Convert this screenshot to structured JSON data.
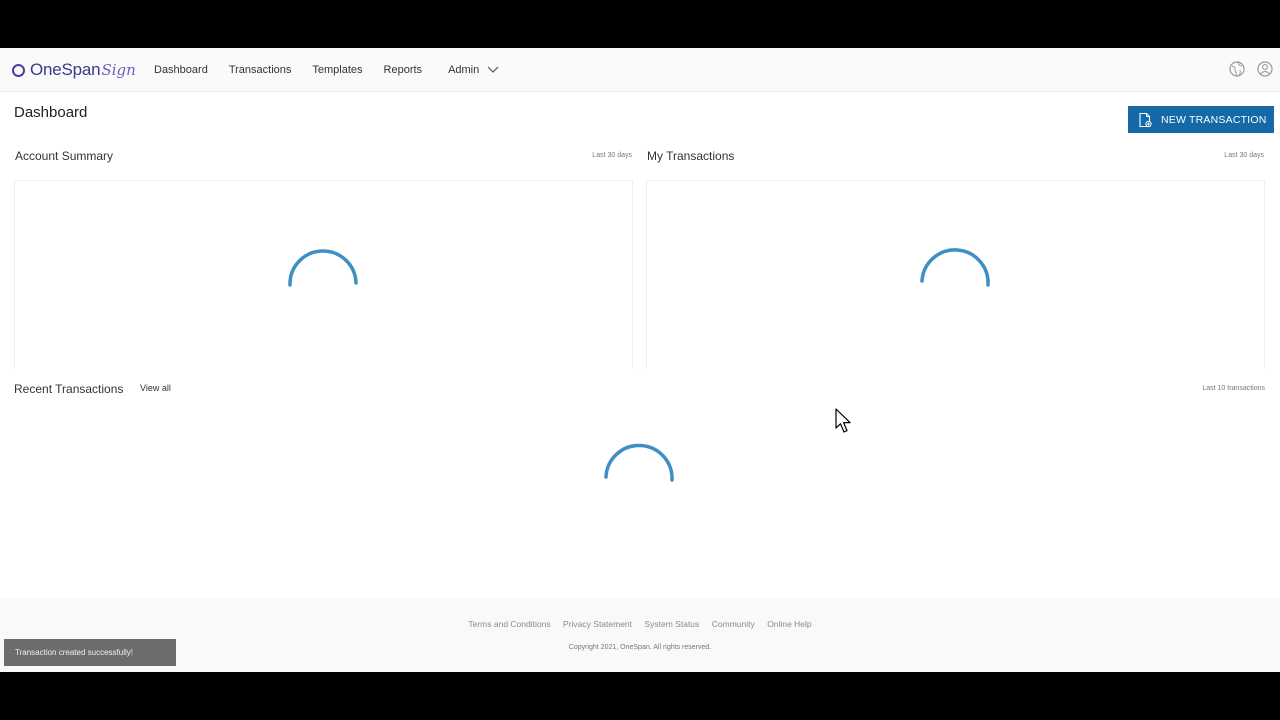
{
  "brand": {
    "name": "OneSpan",
    "suffix": "Sign"
  },
  "nav": {
    "items": [
      "Dashboard",
      "Transactions",
      "Templates",
      "Reports"
    ],
    "admin": "Admin"
  },
  "page": {
    "title": "Dashboard",
    "new_button": "NEW TRANSACTION"
  },
  "account_summary": {
    "title": "Account Summary",
    "range": "Last 30 days"
  },
  "my_transactions": {
    "title": "My Transactions",
    "range": "Last 30 days"
  },
  "recent": {
    "title": "Recent Transactions",
    "view_all": "View all",
    "range": "Last 10 transactions"
  },
  "footer": {
    "links": [
      "Terms and Conditions",
      "Privacy Statement",
      "System Status",
      "Community",
      "Online Help"
    ],
    "copyright": "Copyright 2021, OneSpan. All rights reserved."
  },
  "toast": {
    "message": "Transaction created successfully!"
  },
  "icons": {
    "header": [
      "globe-icon",
      "user-icon"
    ],
    "button": "document-icon",
    "loading": "spinner-icon"
  },
  "colors": {
    "primary": "#1469a6",
    "spinner": "#3d8fc4",
    "brand": "#3a3a8c"
  }
}
